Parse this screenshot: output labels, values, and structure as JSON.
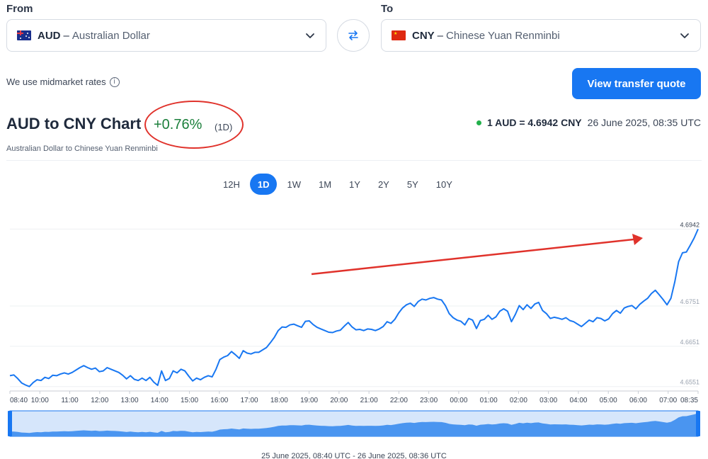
{
  "from": {
    "label": "From",
    "code": "AUD",
    "dash": "–",
    "name": "Australian Dollar"
  },
  "to": {
    "label": "To",
    "code": "CNY",
    "dash": "–",
    "name": "Chinese Yuan Renminbi"
  },
  "swap_icon": "swap-arrows-icon",
  "midmarket_text": "We use midmarket rates",
  "info_icon_glyph": "i",
  "quote_button": "View transfer quote",
  "chart_header": {
    "title": "AUD to CNY Chart",
    "change": "+0.76%",
    "period": "(1D)",
    "subtitle": "Australian Dollar to Chinese Yuan Renminbi",
    "rate": "1 AUD = 4.6942 CNY",
    "timestamp": "26 June 2025, 08:35 UTC"
  },
  "tabs": [
    "12H",
    "1D",
    "1W",
    "1M",
    "1Y",
    "2Y",
    "5Y",
    "10Y"
  ],
  "active_tab": "1D",
  "colors": {
    "accent": "#1877f2",
    "positive": "#1b7f3b",
    "annotation": "#e0322b",
    "live": "#22b04b"
  },
  "range_label": "25 June 2025, 08:40 UTC - 26 June 2025, 08:36 UTC",
  "chart_data": {
    "type": "line",
    "x_ticks": [
      "08:40",
      "10:00",
      "11:00",
      "12:00",
      "13:00",
      "14:00",
      "15:00",
      "16:00",
      "17:00",
      "18:00",
      "19:00",
      "20:00",
      "21:00",
      "22:00",
      "23:00",
      "00:00",
      "01:00",
      "02:00",
      "03:00",
      "04:00",
      "05:00",
      "06:00",
      "07:00",
      "08:35"
    ],
    "y_ticks": [
      "4.6942",
      "4.6751",
      "4.6651",
      "4.6551"
    ],
    "ylim": [
      4.654,
      4.6962
    ],
    "latest_value_label": "4.6942",
    "series": [
      {
        "values": [
          4.6578,
          4.658,
          4.6571,
          4.656,
          4.6555,
          4.6551,
          4.6561,
          4.6568,
          4.6566,
          4.6574,
          4.6571,
          4.6579,
          4.6578,
          4.6582,
          4.6585,
          4.6582,
          4.6586,
          4.6592,
          4.6598,
          4.6603,
          4.6598,
          4.6594,
          4.6597,
          4.6588,
          4.659,
          4.6598,
          4.6594,
          4.659,
          4.6586,
          4.6579,
          4.657,
          4.6578,
          4.6569,
          4.6566,
          4.6572,
          4.6566,
          4.6574,
          4.6562,
          4.6554,
          4.659,
          4.6566,
          4.6571,
          4.659,
          4.6585,
          4.6594,
          4.659,
          4.6577,
          4.6565,
          4.6572,
          4.6568,
          4.6574,
          4.6578,
          4.6575,
          4.6594,
          4.6618,
          4.6624,
          4.6628,
          4.6638,
          4.663,
          4.6621,
          4.664,
          4.6634,
          4.6632,
          4.6636,
          4.6636,
          4.6642,
          4.6648,
          4.666,
          4.6673,
          4.669,
          4.6699,
          4.6698,
          4.6704,
          4.6706,
          4.6702,
          4.6698,
          4.6713,
          4.6714,
          4.6705,
          4.6698,
          4.6694,
          4.669,
          4.6686,
          4.6685,
          4.6689,
          4.6691,
          4.6701,
          4.671,
          4.6699,
          4.6692,
          4.6693,
          4.669,
          4.6694,
          4.6693,
          4.669,
          4.6694,
          4.67,
          4.6712,
          4.6708,
          4.6718,
          4.6734,
          4.6746,
          4.6754,
          4.6758,
          4.675,
          4.6762,
          4.6768,
          4.6766,
          4.677,
          4.6772,
          4.6768,
          4.6766,
          4.6752,
          4.6732,
          4.6722,
          4.6716,
          4.6713,
          4.6704,
          4.672,
          4.6716,
          4.6695,
          4.6715,
          4.6718,
          4.6728,
          4.6718,
          4.6724,
          4.6738,
          4.6744,
          4.6738,
          4.6712,
          4.673,
          4.6752,
          4.6742,
          4.6754,
          4.6745,
          4.6756,
          4.676,
          4.674,
          4.6732,
          4.672,
          4.6723,
          4.6721,
          4.6718,
          4.6722,
          4.6715,
          4.6712,
          4.6706,
          4.67,
          4.6708,
          4.6716,
          4.6712,
          4.6722,
          4.672,
          4.6714,
          4.6719,
          4.6732,
          4.674,
          4.6733,
          4.6746,
          4.675,
          4.6752,
          4.6744,
          4.6755,
          4.6763,
          4.677,
          4.6782,
          4.679,
          4.6779,
          4.6767,
          4.6754,
          4.677,
          4.6811,
          4.6861,
          4.6883,
          4.6885,
          4.6902,
          4.692,
          4.6942
        ]
      }
    ]
  }
}
